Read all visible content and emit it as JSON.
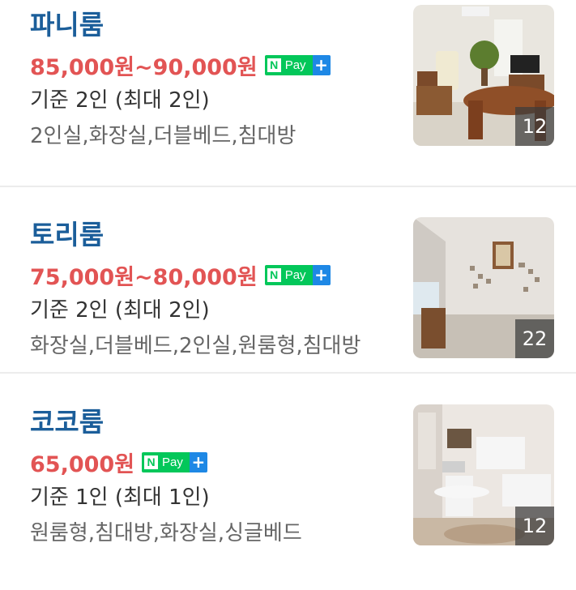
{
  "rooms": [
    {
      "name": "파니룸",
      "price": "85,000원~90,000원",
      "pay_badge": {
        "n": "N",
        "label": "Pay",
        "plus": "+"
      },
      "capacity": "기준 2인 (최대 2인)",
      "tags": "2인실,화장실,더블베드,침대방",
      "photo_count": "12"
    },
    {
      "name": "토리룸",
      "price": "75,000원~80,000원",
      "pay_badge": {
        "n": "N",
        "label": "Pay",
        "plus": "+"
      },
      "capacity": "기준 2인 (최대 2인)",
      "tags": "화장실,더블베드,2인실,원룸형,침대방",
      "photo_count": "22"
    },
    {
      "name": "코코룸",
      "price": "65,000원",
      "pay_badge": {
        "n": "N",
        "label": "Pay",
        "plus": "+"
      },
      "capacity": "기준 1인 (최대 1인)",
      "tags": "원룸형,침대방,화장실,싱글베드",
      "photo_count": "12"
    }
  ],
  "colors": {
    "title": "#1b5e9a",
    "price": "#e25454",
    "npay_green": "#03c75a",
    "npay_blue": "#1e88e5"
  }
}
